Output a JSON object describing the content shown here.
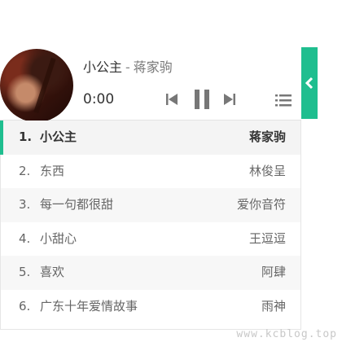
{
  "player": {
    "title": "小公主",
    "separator": "-",
    "artist": "蒋家驹",
    "time": "0:00",
    "cover_icon": "album-cover",
    "controls": [
      "prev-icon",
      "pause-icon",
      "next-icon",
      "list-icon"
    ],
    "accent_color": "#1fbe8f",
    "toggle_icon": "chevron-left-icon"
  },
  "playlist": [
    {
      "num": "1.",
      "name": "小公主",
      "artist": "蒋家驹"
    },
    {
      "num": "2.",
      "name": "东西",
      "artist": "林俊呈"
    },
    {
      "num": "3.",
      "name": "每一句都很甜",
      "artist": "爱你音符"
    },
    {
      "num": "4.",
      "name": "小甜心",
      "artist": "王逗逗"
    },
    {
      "num": "5.",
      "name": "喜欢",
      "artist": "阿肆"
    },
    {
      "num": "6.",
      "name": "广东十年爱情故事",
      "artist": "雨神"
    }
  ],
  "watermark": "www.kcblog.top"
}
